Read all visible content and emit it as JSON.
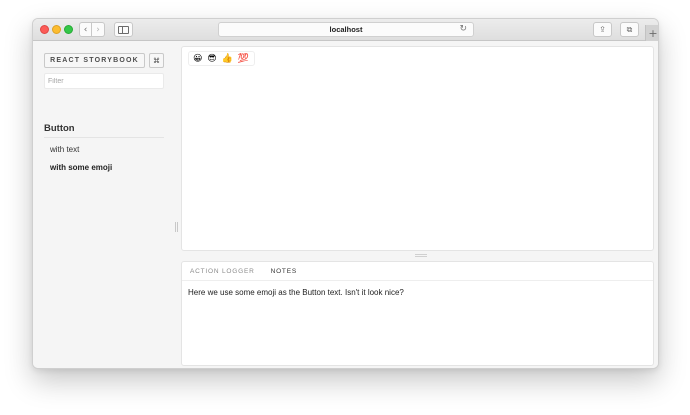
{
  "browser": {
    "url": "localhost",
    "nav_back_icon": "‹",
    "nav_forward_icon": "›",
    "reload_icon": "↻",
    "share_icon": "⇪",
    "tabs_icon": "⧉",
    "new_tab_icon": "+"
  },
  "sidebar": {
    "header_label": "REACT STORYBOOK",
    "shortcut_icon": "⌘",
    "filter_placeholder": "Filter",
    "kinds": [
      {
        "title": "Button",
        "stories": [
          {
            "label": "with text",
            "selected": false
          },
          {
            "label": "with some emoji",
            "selected": true
          }
        ]
      }
    ]
  },
  "preview": {
    "button_text": "😀 😎 👍 💯"
  },
  "addons": {
    "tabs": [
      {
        "label": "ACTION LOGGER",
        "active": false
      },
      {
        "label": "NOTES",
        "active": true
      }
    ],
    "notes_text": "Here we use some emoji as the Button text. Isn't it look nice?"
  },
  "colors": {
    "traffic_close": "#fc5b57",
    "traffic_minimize": "#fcbc2f",
    "traffic_maximize": "#33c748"
  }
}
